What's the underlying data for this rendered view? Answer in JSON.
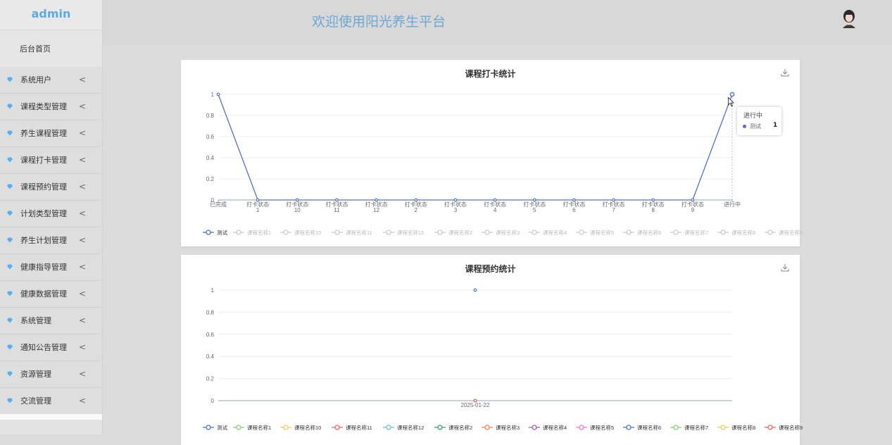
{
  "sidebar": {
    "brand": "admin",
    "home": "后台首页",
    "items": [
      {
        "label": "系统用户"
      },
      {
        "label": "课程类型管理"
      },
      {
        "label": "养生课程管理"
      },
      {
        "label": "课程打卡管理"
      },
      {
        "label": "课程预约管理"
      },
      {
        "label": "计划类型管理"
      },
      {
        "label": "养生计划管理"
      },
      {
        "label": "健康指导管理"
      },
      {
        "label": "健康数据管理"
      },
      {
        "label": "系统管理"
      },
      {
        "label": "通知公告管理"
      },
      {
        "label": "资源管理"
      },
      {
        "label": "交流管理"
      }
    ],
    "chevron": "<",
    "icon": "diamond-icon",
    "icon_color": "#5aaee8"
  },
  "header": {
    "title": "欢迎使用阳光养生平台",
    "avatar": "user-avatar"
  },
  "tooltip": {
    "category": "进行中",
    "series": "测试",
    "value": "1"
  },
  "chart_data": [
    {
      "type": "line",
      "title": "课程打卡统计",
      "categories": [
        "已完成",
        "打卡状态 1",
        "打卡状态 10",
        "打卡状态 11",
        "打卡状态 12",
        "打卡状态 2",
        "打卡状态 3",
        "打卡状态 4",
        "打卡状态 5",
        "打卡状态 6",
        "打卡状态 7",
        "打卡状态 8",
        "打卡状态 9",
        "进行中"
      ],
      "yticks": [
        "0",
        "0.2",
        "0.4",
        "0.6",
        "0.8",
        "1"
      ],
      "ylim": [
        0,
        1
      ],
      "series": [
        {
          "name": "测试",
          "values": [
            1,
            0,
            0,
            0,
            0,
            0,
            0,
            0,
            0,
            0,
            0,
            0,
            0,
            1
          ],
          "color": "#5470c6",
          "active": true
        },
        {
          "name": "课程名称1",
          "active": false
        },
        {
          "name": "课程名称10",
          "active": false
        },
        {
          "name": "课程名称11",
          "active": false
        },
        {
          "name": "课程名称12",
          "active": false
        },
        {
          "name": "课程名称2",
          "active": false
        },
        {
          "name": "课程名称3",
          "active": false
        },
        {
          "name": "课程名称4",
          "active": false
        },
        {
          "name": "课程名称5",
          "active": false
        },
        {
          "name": "课程名称6",
          "active": false
        },
        {
          "name": "课程名称7",
          "active": false
        },
        {
          "name": "课程名称8",
          "active": false
        },
        {
          "name": "课程名称9",
          "active": false
        }
      ],
      "grid": true,
      "legend": "bottom"
    },
    {
      "type": "line",
      "title": "课程预约统计",
      "categories": [
        "2025-01-22"
      ],
      "yticks": [
        "0",
        "0.2",
        "0.4",
        "0.6",
        "0.8",
        "1"
      ],
      "ylim": [
        0,
        1
      ],
      "series": [
        {
          "name": "测试",
          "values": [
            1
          ],
          "color": "#5470c6"
        },
        {
          "name": "课程名称1",
          "values": [
            0
          ],
          "color": "#91cc75"
        },
        {
          "name": "课程名称10",
          "values": [
            0
          ],
          "color": "#fac858"
        },
        {
          "name": "课程名称11",
          "values": [
            0
          ],
          "color": "#ee6666"
        },
        {
          "name": "课程名称12",
          "values": [
            0
          ],
          "color": "#73c0de"
        },
        {
          "name": "课程名称2",
          "values": [
            0
          ],
          "color": "#3ba272"
        },
        {
          "name": "课程名称3",
          "values": [
            0
          ],
          "color": "#fc8452"
        },
        {
          "name": "课程名称4",
          "values": [
            0
          ],
          "color": "#9a60b4"
        },
        {
          "name": "课程名称5",
          "values": [
            0
          ],
          "color": "#ea7ccc"
        },
        {
          "name": "课程名称6",
          "values": [
            0
          ],
          "color": "#5470c6"
        },
        {
          "name": "课程名称7",
          "values": [
            0
          ],
          "color": "#91cc75"
        },
        {
          "name": "课程名称8",
          "values": [
            0
          ],
          "color": "#fac858"
        },
        {
          "name": "课程名称9",
          "values": [
            0
          ],
          "color": "#ee6666"
        }
      ],
      "grid": true,
      "legend": "bottom"
    }
  ]
}
